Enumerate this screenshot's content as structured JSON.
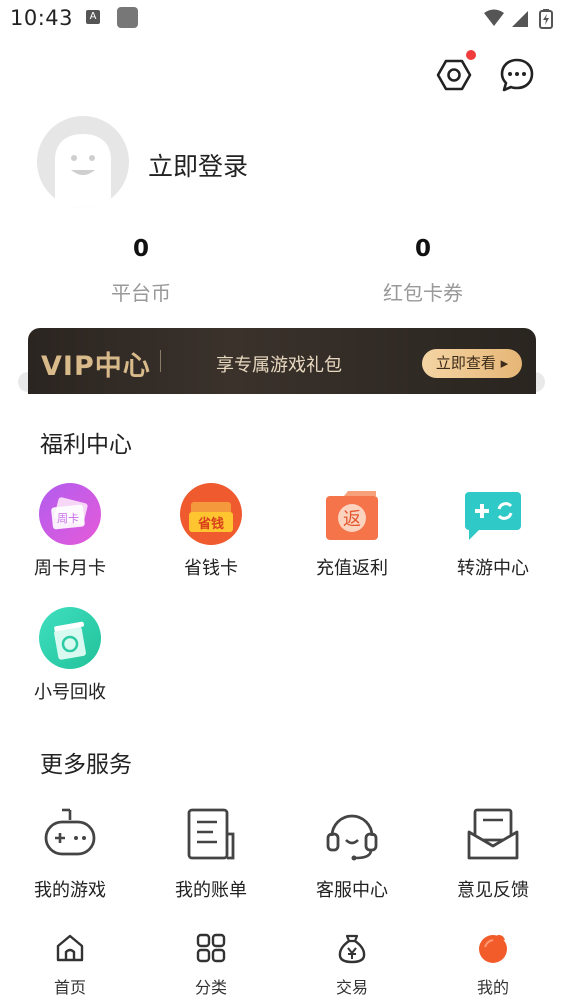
{
  "status_bar": {
    "time": "10:43",
    "notif_letter": "A"
  },
  "profile": {
    "login_text": "立即登录"
  },
  "stats": [
    {
      "value": "0",
      "label": "平台币"
    },
    {
      "value": "0",
      "label": "红包卡券"
    }
  ],
  "vip": {
    "title": "VIP中心",
    "text": "享专属游戏礼包",
    "button": "立即查看 ▸"
  },
  "welfare": {
    "title": "福利中心",
    "items": [
      {
        "label": "周卡月卡",
        "icon": "week-month-card-icon",
        "icon_text": "周卡"
      },
      {
        "label": "省钱卡",
        "icon": "save-money-card-icon",
        "icon_text": "省钱"
      },
      {
        "label": "充值返利",
        "icon": "recharge-rebate-icon",
        "icon_text": "返"
      },
      {
        "label": "转游中心",
        "icon": "transfer-game-icon"
      },
      {
        "label": "小号回收",
        "icon": "account-recycle-icon"
      }
    ]
  },
  "services": {
    "title": "更多服务",
    "items": [
      {
        "label": "我的游戏",
        "icon": "gamepad-icon"
      },
      {
        "label": "我的账单",
        "icon": "bill-icon"
      },
      {
        "label": "客服中心",
        "icon": "headset-icon"
      },
      {
        "label": "意见反馈",
        "icon": "feedback-mail-icon"
      }
    ]
  },
  "bottom_nav": [
    {
      "label": "首页",
      "icon": "home-icon"
    },
    {
      "label": "分类",
      "icon": "category-grid-icon"
    },
    {
      "label": "交易",
      "icon": "money-bag-icon"
    },
    {
      "label": "我的",
      "icon": "mine-icon",
      "active": true
    }
  ],
  "colors": {
    "accent": "#f25c2a",
    "vip_gold": "#d9ba8a",
    "notify_red": "#f23b3b"
  }
}
